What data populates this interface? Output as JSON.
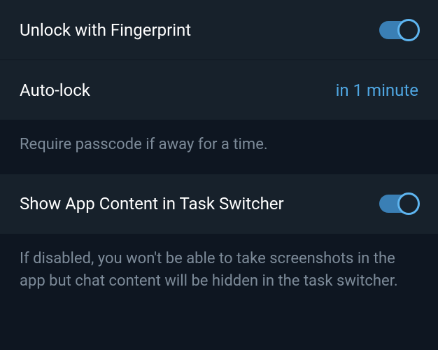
{
  "settings": {
    "fingerprint": {
      "label": "Unlock with Fingerprint",
      "enabled": true
    },
    "autolock": {
      "label": "Auto-lock",
      "value": "in 1 minute",
      "description": "Require passcode if away for a time."
    },
    "task_switcher": {
      "label": "Show App Content in Task Switcher",
      "enabled": true,
      "description": "If disabled, you won't be able to take screenshots in the app but chat content will be hidden in the task switcher."
    }
  }
}
